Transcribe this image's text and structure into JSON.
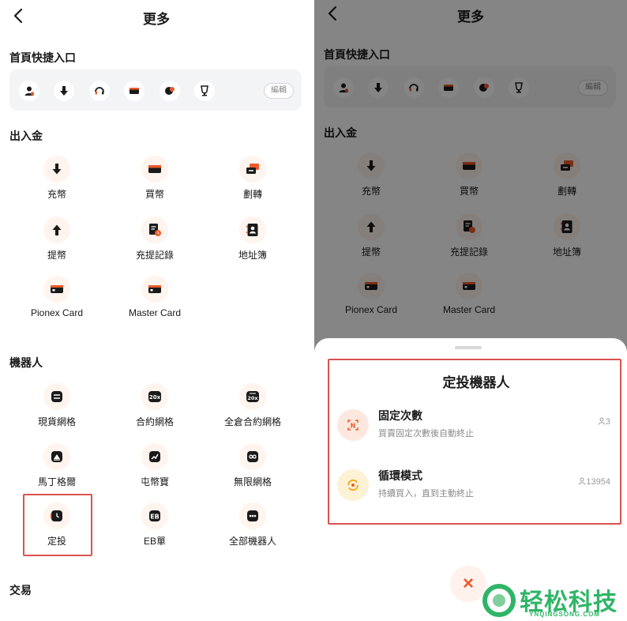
{
  "header": {
    "title": "更多"
  },
  "sections": {
    "shortcuts": "首頁快捷入口",
    "deposit": "出入金",
    "robots": "機器人",
    "trade": "交易"
  },
  "shortcut_bar": {
    "icons": [
      "user-icon",
      "download-icon",
      "headset-icon",
      "card-icon",
      "refresh-icon",
      "trophy-icon"
    ],
    "edit_label": "編輯"
  },
  "deposit_items": [
    {
      "label": "充幣",
      "icon": "arrow-down-icon"
    },
    {
      "label": "買幣",
      "icon": "card-icon"
    },
    {
      "label": "劃轉",
      "icon": "transfer-icon"
    },
    {
      "label": "提幣",
      "icon": "arrow-up-icon"
    },
    {
      "label": "充提記錄",
      "icon": "record-icon"
    },
    {
      "label": "地址簿",
      "icon": "address-book-icon"
    },
    {
      "label": "Pionex Card",
      "icon": "pionex-card-icon"
    },
    {
      "label": "Master Card",
      "icon": "master-card-icon"
    }
  ],
  "robot_items": [
    {
      "label": "現貨網格",
      "icon": "spot-grid-icon"
    },
    {
      "label": "合約網格",
      "icon": "futures-grid-icon"
    },
    {
      "label": "全倉合約網格",
      "icon": "cross-grid-icon"
    },
    {
      "label": "馬丁格爾",
      "icon": "martingale-icon"
    },
    {
      "label": "屯幣寶",
      "icon": "chart-icon"
    },
    {
      "label": "無限網格",
      "icon": "infinity-icon"
    },
    {
      "label": "定投",
      "icon": "clock-icon"
    },
    {
      "label": "EB單",
      "icon": "eb-icon"
    },
    {
      "label": "全部機器人",
      "icon": "more-icon"
    }
  ],
  "sheet": {
    "title": "定投機器人",
    "options": [
      {
        "title": "固定次數",
        "subtitle": "買賣固定次數後自動終止",
        "count": "3",
        "icon": "fixed-count-icon"
      },
      {
        "title": "循環模式",
        "subtitle": "持續買入，直到主動終止",
        "count": "13954",
        "icon": "cycle-icon"
      }
    ],
    "close_label": "×"
  },
  "colors": {
    "accent": "#ec5b2b",
    "icon_bg": "#fff4ee",
    "highlight": "#d9534f"
  },
  "watermark": {
    "text": "轻松科技",
    "sub": "YNQINGSONG.COM"
  }
}
